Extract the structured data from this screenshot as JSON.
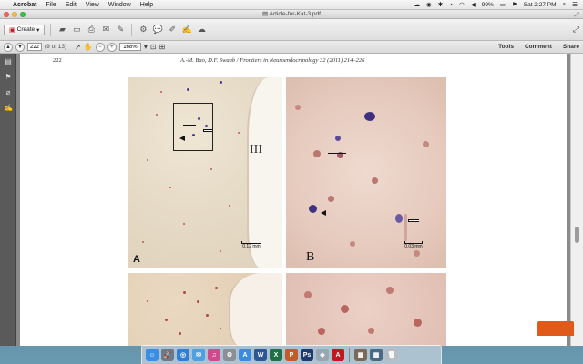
{
  "menubar": {
    "app_name": "Acrobat",
    "items": [
      "File",
      "Edit",
      "View",
      "Window",
      "Help"
    ],
    "battery": "99%",
    "clock": "Sat 2:27 PM"
  },
  "window": {
    "title": "Article-for-Kat-3.pdf"
  },
  "toolbar": {
    "create_label": "Create",
    "page_input": "222",
    "page_count": "(9 of 13)",
    "zoom_value": "168%",
    "tools_label": "Tools",
    "comment_label": "Comment",
    "share_label": "Share"
  },
  "document": {
    "page_number": "222",
    "running_title": "A.-M. Bao, D.F. Swaab / Frontiers in Neuroendocrinology 32 (2011) 214–226",
    "figure": {
      "panel_a_label": "A",
      "panel_b_label": "B",
      "ventricle_label": "III",
      "scale_a": "0.12 mm",
      "scale_b": "0.03 mm"
    }
  },
  "colors": {
    "stain_purple": "#4b3a8f",
    "stain_red": "#c0574f",
    "close": "#fc605c",
    "minimize": "#fdbc40",
    "maximize": "#34c84a"
  },
  "dock": {
    "icons": [
      "finder-icon",
      "launchpad-icon",
      "safari-icon",
      "mail-icon",
      "itunes-icon",
      "settings-icon",
      "appstore-icon",
      "word-icon",
      "excel-icon",
      "powerpoint-icon",
      "photoshop-icon",
      "preview-icon",
      "acrobat-icon",
      "photos-icon",
      "downloads-icon",
      "trash-icon"
    ]
  }
}
